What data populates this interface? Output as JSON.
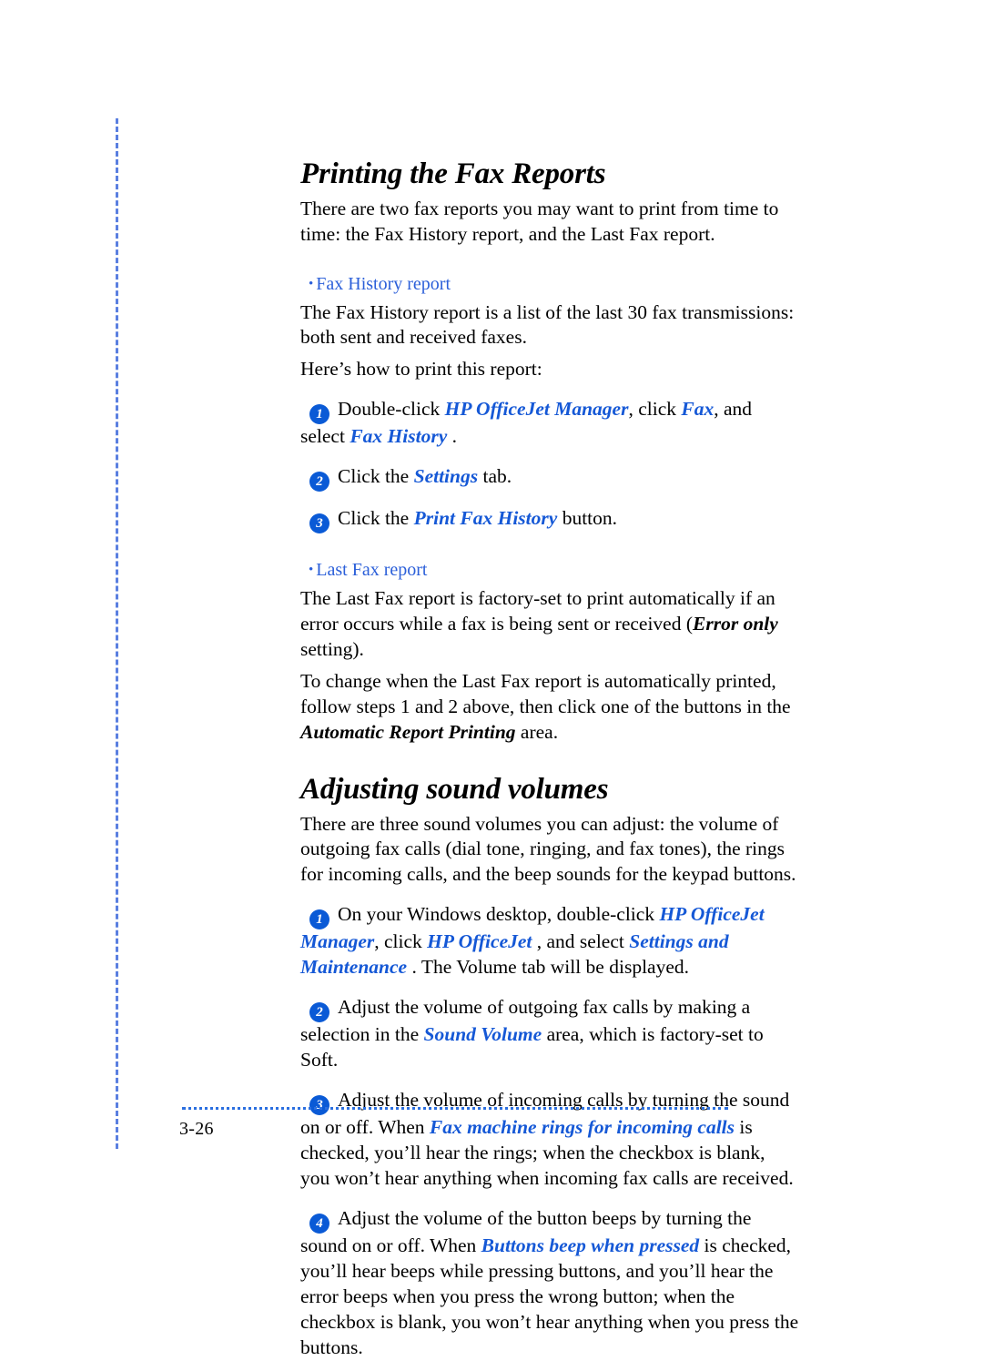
{
  "page": {
    "number": "3-26",
    "accent_blue": "#1558d6",
    "heading_blue": "#2b5fd9",
    "marker_blue": "#0a5ad6",
    "rule_blue": "#2b6fe0"
  },
  "section_one": {
    "title": "Printing the Fax Reports",
    "intro": "There are two fax reports you may want to print from time to time: the Fax History report, and the Last Fax report.",
    "bullet_one": {
      "dot": "•",
      "label": "Fax History report",
      "paragraph": "The Fax History report is a list of the last 30 fax transmissions: both sent and received faxes.",
      "lead_in": "Here’s how to print this report:"
    },
    "steps": [
      {
        "number": "1",
        "text_a": "Double-click ",
        "ui_a": "HP OfficeJet Manager",
        "text_b": ", click ",
        "ui_b": "Fax",
        "text_c": ", and select ",
        "ui_c": "Fax History",
        "text_d": " ."
      },
      {
        "number": "2",
        "text_a": "Click the ",
        "ui_a": "Settings",
        "text_b": "  tab."
      },
      {
        "number": "3",
        "text_a": "Click the ",
        "ui_a": "Print Fax History",
        "text_b": "  button."
      }
    ],
    "bullet_two": {
      "dot": "•",
      "label": "Last Fax report",
      "paragraph_a1": "The Last Fax report is factory-set to print automatically if an error occurs while a fax is being sent or received (",
      "paragraph_a_em": "Error only",
      "paragraph_a2": "  setting).",
      "paragraph_b1": "To change when the Last Fax report is automatically printed, follow steps 1 and 2 above, then click one of the buttons in the ",
      "paragraph_b_em": "Automatic Report Printing",
      "paragraph_b2": "  area."
    }
  },
  "section_two": {
    "title": "Adjusting sound volumes",
    "intro": "There are three sound volumes you can adjust: the volume of outgoing fax calls (dial tone, ringing, and fax tones), the rings for incoming calls, and the beep sounds for the keypad buttons.",
    "steps": [
      {
        "number": "1",
        "text_a": "On your Windows desktop, double-click ",
        "ui_a": "HP OfficeJet Manager",
        "text_b": ", click ",
        "ui_b": "HP OfficeJet",
        "text_c": " , and select ",
        "ui_c": "Settings and Maintenance",
        "text_d": " . The Volume tab will be displayed."
      },
      {
        "number": "2",
        "text_a": "Adjust the volume of outgoing fax calls by making a selection in the ",
        "ui_a": "Sound Volume",
        "text_b": "  area, which is factory-set to Soft."
      },
      {
        "number": "3",
        "text_a": "Adjust the volume of incoming calls by turning the sound on or off. When ",
        "ui_a": "Fax machine rings for incoming calls",
        "text_b": "  is checked, you’ll hear the rings; when the checkbox is blank, you won’t hear anything when incoming fax calls are received."
      },
      {
        "number": "4",
        "text_a": "Adjust the volume of the button beeps by turning the sound on or off. When ",
        "ui_a": "Buttons beep when pressed",
        "text_b": "  is checked, you’ll hear beeps while pressing buttons, and you’ll hear the error beeps when you press the wrong button; when the checkbox is blank, you won’t hear anything when you press the buttons."
      }
    ]
  }
}
